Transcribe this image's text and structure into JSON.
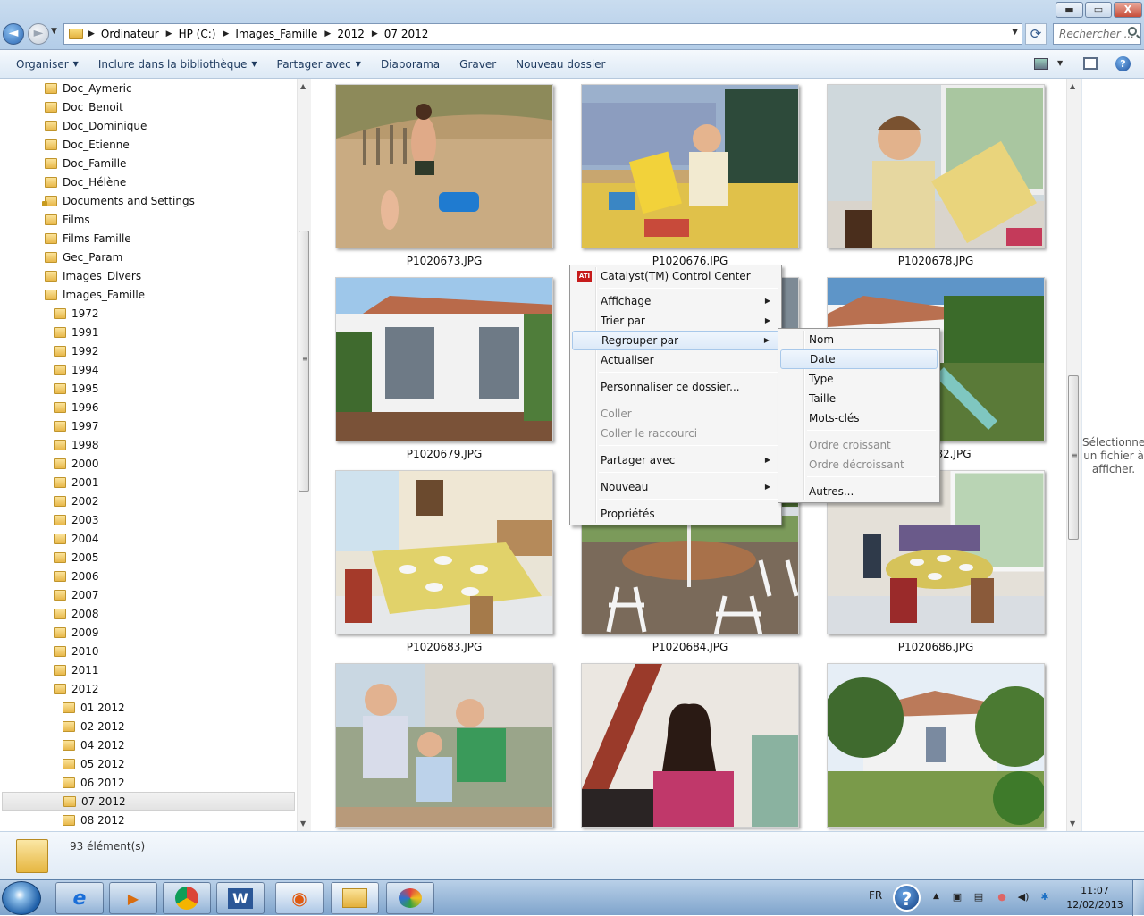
{
  "window": {
    "caption": {
      "minimize": "▬",
      "maximize": "▭",
      "close": "X"
    }
  },
  "address": {
    "crumbs": [
      "Ordinateur",
      "HP (C:)",
      "Images_Famille",
      "2012",
      "07 2012"
    ],
    "search_placeholder": "Rechercher ..."
  },
  "toolbar": {
    "organize": "Organiser",
    "include": "Inclure dans la bibliothèque",
    "share": "Partager avec",
    "slideshow": "Diaporama",
    "burn": "Graver",
    "new_folder": "Nouveau dossier",
    "help": "?"
  },
  "nav": {
    "level1": [
      "Doc_Aymeric",
      "Doc_Benoit",
      "Doc_Dominique",
      "Doc_Etienne",
      "Doc_Famille",
      "Doc_Hélène",
      "Documents and Settings",
      "Films",
      "Films Famille",
      "Gec_Param",
      "Images_Divers",
      "Images_Famille"
    ],
    "years": [
      "1972",
      "1991",
      "1992",
      "1994",
      "1995",
      "1996",
      "1997",
      "1998",
      "2000",
      "2001",
      "2002",
      "2003",
      "2004",
      "2005",
      "2006",
      "2007",
      "2008",
      "2009",
      "2010",
      "2011",
      "2012"
    ],
    "months": [
      "01 2012",
      "02 2012",
      "04 2012",
      "05 2012",
      "06 2012",
      "07 2012",
      "08 2012"
    ],
    "selected": "07 2012"
  },
  "files": [
    {
      "name": "P1020673.JPG",
      "scene": "beach"
    },
    {
      "name": "P1020676.JPG",
      "scene": "reading"
    },
    {
      "name": "P1020678.JPG",
      "scene": "boy"
    },
    {
      "name": "P1020679.JPG",
      "scene": "house"
    },
    {
      "name": "",
      "scene": "hidden"
    },
    {
      "name": "P1020682.JPG",
      "scene": "garden"
    },
    {
      "name": "P1020683.JPG",
      "scene": "dining"
    },
    {
      "name": "P1020684.JPG",
      "scene": "patio"
    },
    {
      "name": "P1020686.JPG",
      "scene": "dining2"
    },
    {
      "name": "",
      "scene": "sofa"
    },
    {
      "name": "",
      "scene": "girl"
    },
    {
      "name": "",
      "scene": "garden2"
    }
  ],
  "file_partial_caption": "82.JPG",
  "context_menu": {
    "items": [
      {
        "label": "Catalyst(TM) Control Center",
        "icon": "ati-icon"
      },
      {
        "label": "Affichage",
        "submenu": true
      },
      {
        "label": "Trier par",
        "submenu": true
      },
      {
        "label": "Regrouper par",
        "submenu": true,
        "highlighted": true
      },
      {
        "label": "Actualiser"
      },
      {
        "label": "Personnaliser ce dossier..."
      },
      {
        "label": "Coller",
        "disabled": true
      },
      {
        "label": "Coller le raccourci",
        "disabled": true
      },
      {
        "label": "Partager avec",
        "submenu": true
      },
      {
        "label": "Nouveau",
        "submenu": true
      },
      {
        "label": "Propriétés"
      }
    ]
  },
  "submenu": {
    "items": [
      {
        "label": "Nom"
      },
      {
        "label": "Date",
        "highlighted": true
      },
      {
        "label": "Type"
      },
      {
        "label": "Taille"
      },
      {
        "label": "Mots-clés"
      },
      {
        "label": "Ordre croissant",
        "disabled": true
      },
      {
        "label": "Ordre décroissant",
        "disabled": true
      },
      {
        "label": "Autres..."
      }
    ]
  },
  "preview": {
    "message": "Sélectionnez un fichier à afficher."
  },
  "details": {
    "count": "93 élément(s)"
  },
  "taskbar": {
    "apps": [
      "internet-explorer",
      "media-player",
      "chrome",
      "word",
      "eye-app",
      "explorer",
      "paint"
    ],
    "word_letter": "W",
    "lang": "FR",
    "help": "?",
    "time": "11:07",
    "date": "12/02/2013"
  }
}
